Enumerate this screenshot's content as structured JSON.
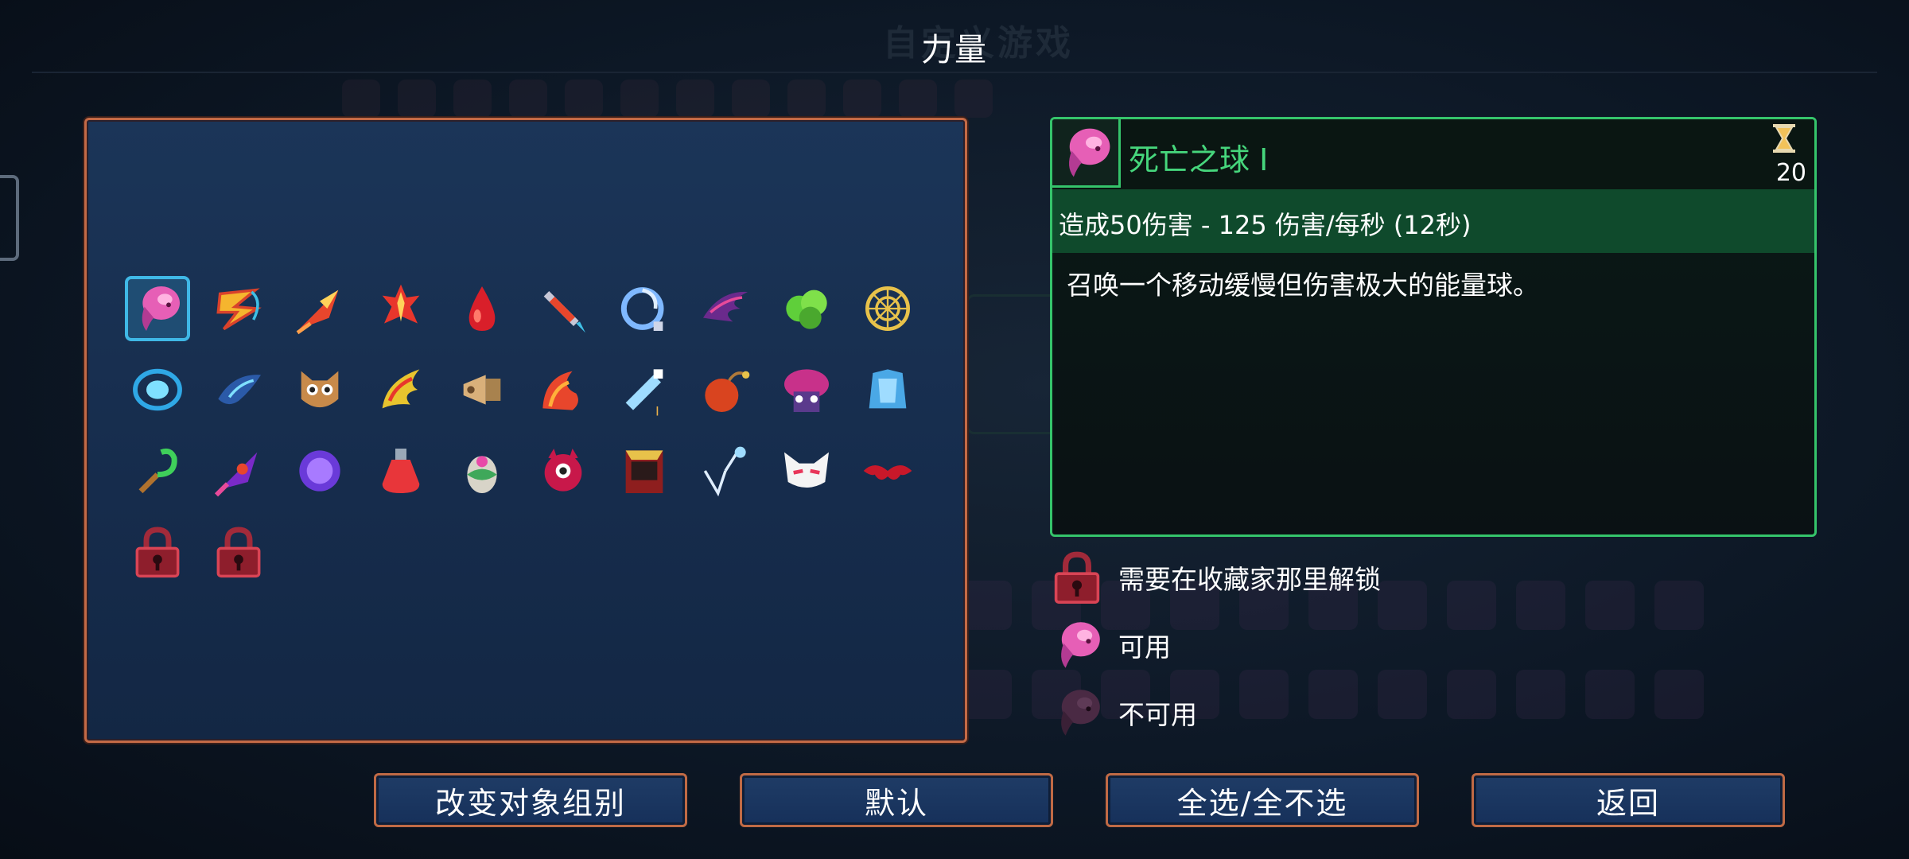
{
  "title": "力量",
  "background_title": "自定义游戏",
  "grid": {
    "items": [
      {
        "icon": "death-orb-icon",
        "selected": true
      },
      {
        "icon": "lightning-ring-icon"
      },
      {
        "icon": "meteor-arrow-icon"
      },
      {
        "icon": "fire-cross-icon"
      },
      {
        "icon": "blood-drop-icon"
      },
      {
        "icon": "rocket-icon"
      },
      {
        "icon": "ice-orb-icon"
      },
      {
        "icon": "shadow-claw-icon"
      },
      {
        "icon": "poison-cloud-icon"
      },
      {
        "icon": "gold-web-icon"
      },
      {
        "icon": "wind-vortex-icon"
      },
      {
        "icon": "fish-blade-icon"
      },
      {
        "icon": "owl-mask-icon"
      },
      {
        "icon": "fire-wing-icon"
      },
      {
        "icon": "megaphone-icon"
      },
      {
        "icon": "flame-wave-icon"
      },
      {
        "icon": "crystal-potion-icon"
      },
      {
        "icon": "bomb-icon"
      },
      {
        "icon": "mushroom-monster-icon"
      },
      {
        "icon": "ice-armor-icon"
      },
      {
        "icon": "green-hook-icon"
      },
      {
        "icon": "purple-rocket-icon"
      },
      {
        "icon": "purple-orb-icon"
      },
      {
        "icon": "red-potion-icon"
      },
      {
        "icon": "gem-egg-icon"
      },
      {
        "icon": "eye-demon-icon"
      },
      {
        "icon": "spellbook-icon"
      },
      {
        "icon": "ice-shards-icon"
      },
      {
        "icon": "cat-mask-icon"
      },
      {
        "icon": "bat-icon"
      },
      {
        "icon": "lock-icon"
      },
      {
        "icon": "lock-icon"
      }
    ]
  },
  "details": {
    "name": "死亡之球 I",
    "cooldown": "20",
    "damage": "造成50伤害 - 125 伤害/每秒 (12秒)",
    "description": "召唤一个移动缓慢但伤害极大的能量球。"
  },
  "legend": [
    {
      "icon": "lock-icon",
      "label": "需要在收藏家那里解锁"
    },
    {
      "icon": "death-orb-icon",
      "label": "可用"
    },
    {
      "icon": "death-orb-dim-icon",
      "label": "不可用"
    }
  ],
  "buttons": {
    "change_group": "改变对象组别",
    "default": "默认",
    "select_all": "全选/全不选",
    "back": "返回"
  },
  "colors": {
    "accent_green": "#35c46b",
    "panel_border": "#c46a46",
    "selection_blue": "#3fb8e6"
  }
}
